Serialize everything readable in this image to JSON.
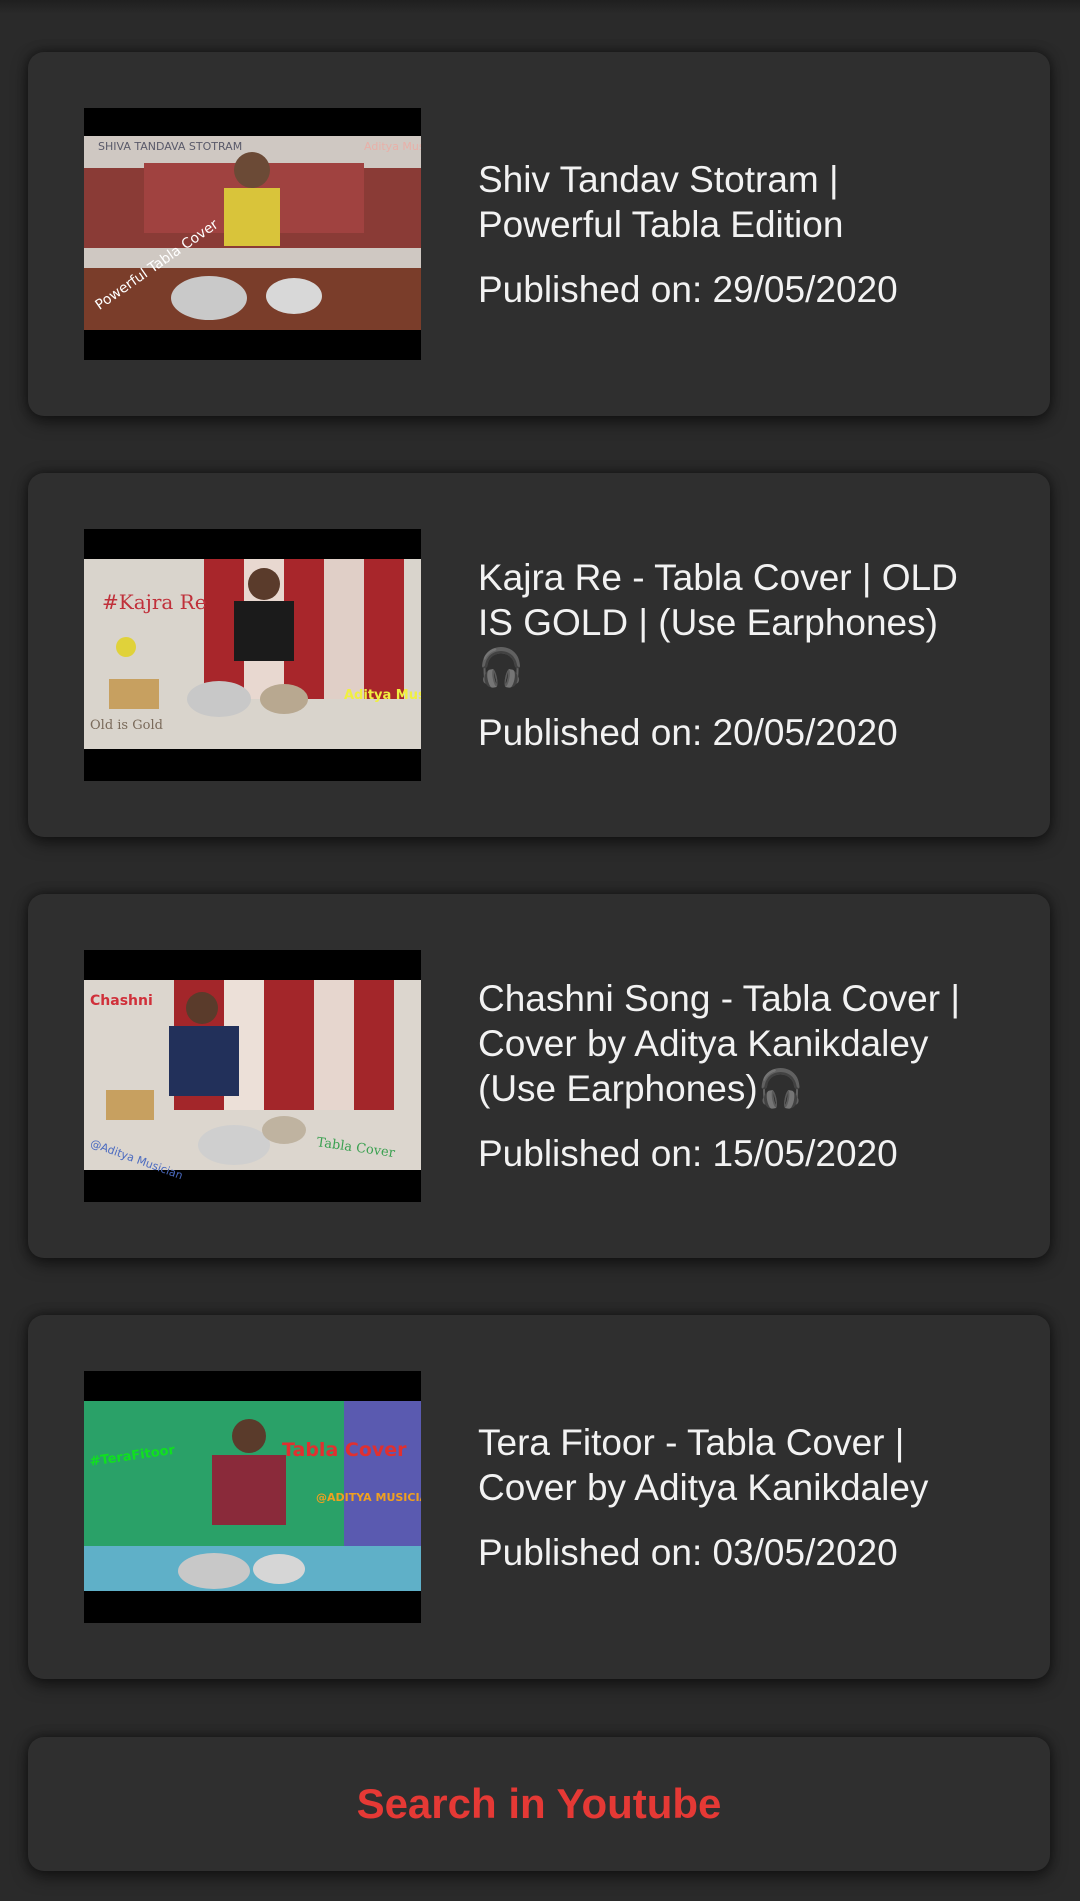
{
  "videos": [
    {
      "title": "Shiv Tandav Stotram | Powerful Tabla Edition",
      "date": "Published on: 29/05/2020",
      "thumb_caption_1": "SHIVA TANDAVA STOTRAM",
      "thumb_caption_2": "Aditya Musician",
      "thumb_caption_3": "Powerful Tabla Cover"
    },
    {
      "title": "Kajra Re - Tabla Cover | OLD IS GOLD | (Use Earphones) 🎧",
      "date": "Published on: 20/05/2020",
      "thumb_caption_1": "#Kajra Re",
      "thumb_caption_2": "Aditya Musician",
      "thumb_caption_3": "Old is Gold"
    },
    {
      "title": "Chashni Song - Tabla Cover | Cover by Aditya Kanikdaley (Use Earphones)🎧",
      "date": "Published on: 15/05/2020",
      "thumb_caption_1": "Chashni",
      "thumb_caption_2": "@Aditya Musician",
      "thumb_caption_3": "Tabla Cover"
    },
    {
      "title": "Tera Fitoor - Tabla Cover | Cover by Aditya Kanikdaley",
      "date": "Published on: 03/05/2020",
      "thumb_caption_1": "#TeraFitoor",
      "thumb_caption_2": "Tabla Cover",
      "thumb_caption_3": "@ADITYA MUSICIAN"
    }
  ],
  "search_button": {
    "label": "Search in Youtube",
    "color": "#e53935"
  },
  "colors": {
    "background": "#2a2a2a",
    "card": "#2f2f2f",
    "text": "#f2f2f2"
  }
}
